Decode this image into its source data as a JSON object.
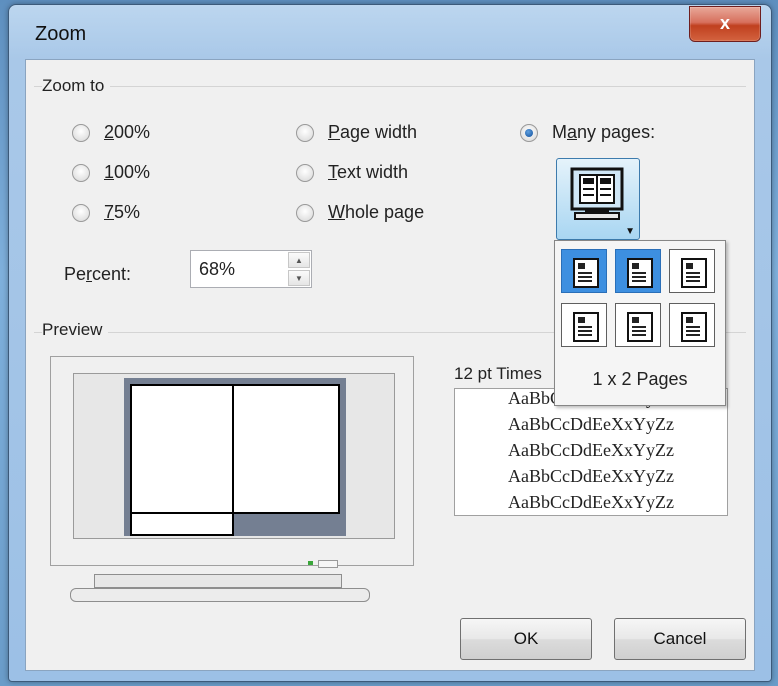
{
  "window": {
    "title": "Zoom",
    "close_icon": "close-icon",
    "close_glyph": "x"
  },
  "zoom_to": {
    "label": "Zoom to",
    "options": [
      {
        "accesskey": "2",
        "rest": "00%",
        "selected": false
      },
      {
        "accesskey": "1",
        "rest": "00%",
        "selected": false
      },
      {
        "accesskey": "7",
        "rest": "5%",
        "selected": false
      },
      {
        "accesskey": "P",
        "rest": "age width",
        "selected": false
      },
      {
        "accesskey": "T",
        "rest": "ext width",
        "selected": false
      },
      {
        "accesskey": "W",
        "rest": "hole page",
        "selected": false
      },
      {
        "pre": "M",
        "accesskey": "a",
        "rest": "ny pages:",
        "selected": true
      }
    ]
  },
  "percent": {
    "pre": "Pe",
    "accesskey": "r",
    "rest": "cent:",
    "value": "68%"
  },
  "many_pages_picker": {
    "button_icon": "multiple-pages-icon",
    "selected_label": "1 x 2 Pages",
    "grid": [
      [
        true,
        true,
        false
      ],
      [
        false,
        false,
        false
      ]
    ]
  },
  "preview": {
    "label": "Preview",
    "font_label": "12 pt Times",
    "sample_lines": [
      "AaBbCcDdEeXxYyZz",
      "AaBbCcDdEeXxYyZz",
      "AaBbCcDdEeXxYyZz",
      "AaBbCcDdEeXxYyZz",
      "AaBbCcDdEeXxYyZz"
    ]
  },
  "buttons": {
    "ok": "OK",
    "cancel": "Cancel"
  }
}
